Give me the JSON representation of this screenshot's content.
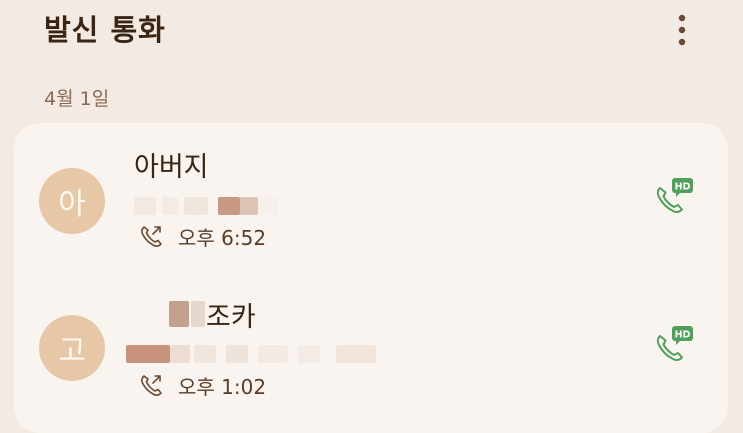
{
  "header": {
    "title": "발신 통화",
    "more_icon": "more-vertical-icon"
  },
  "section": {
    "date_label": "4월 1일"
  },
  "calls": [
    {
      "avatar_initial": "아",
      "name": "아버지",
      "direction_icon": "outgoing-call-icon",
      "time": "오후 6:52",
      "action_icon": "hd-call-icon"
    },
    {
      "avatar_initial": "고",
      "name": "조카",
      "direction_icon": "outgoing-call-icon",
      "time": "오후 1:02",
      "action_icon": "hd-call-icon"
    }
  ],
  "colors": {
    "background": "#f3ebe3",
    "card": "#f9f4ef",
    "title": "#3a2412",
    "avatar_bg": "#e6c7a6",
    "hd_call_green": "#4fa05a"
  }
}
